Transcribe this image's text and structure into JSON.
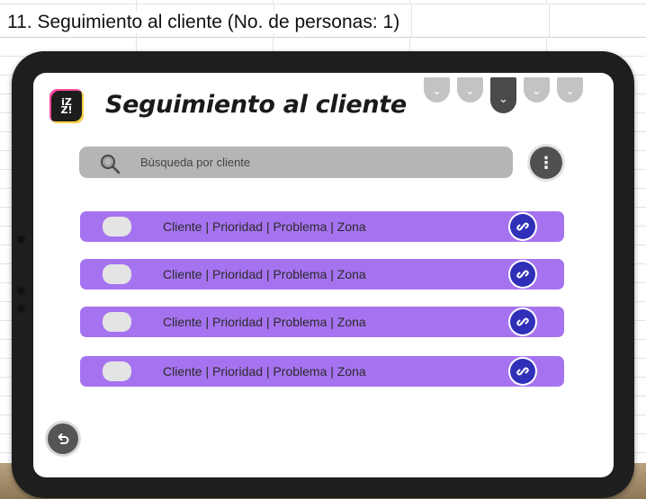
{
  "sheet": {
    "title": "11. Seguimiento al cliente (No. de personas: 1)"
  },
  "app": {
    "logo_text": "iZ Z!",
    "title": "Seguimiento al cliente",
    "tabs": [
      {
        "icon": "chevron-down-icon",
        "active": false
      },
      {
        "icon": "chevron-down-icon",
        "active": false
      },
      {
        "icon": "chevron-down-icon",
        "active": true
      },
      {
        "icon": "chevron-down-icon",
        "active": false
      },
      {
        "icon": "chevron-down-icon",
        "active": false
      }
    ],
    "search": {
      "placeholder": "Búsqueda por cliente",
      "value": ""
    },
    "menu_icon": "more-vertical-icon",
    "rows": [
      {
        "label": "Cliente | Prioridad | Problema | Zona",
        "icon": "link-icon"
      },
      {
        "label": "Cliente | Prioridad | Problema | Zona",
        "icon": "link-icon"
      },
      {
        "label": "Cliente | Prioridad | Problema | Zona",
        "icon": "link-icon"
      },
      {
        "label": "Cliente | Prioridad | Problema | Zona",
        "icon": "link-icon"
      }
    ],
    "back_icon": "undo-icon"
  },
  "colors": {
    "row_purple": "#a673f0",
    "link_blue": "#2f2fb8",
    "search_gray": "#b5b5b5",
    "tab_gray": "#c3c3c3",
    "tab_active": "#4a4a4a"
  }
}
